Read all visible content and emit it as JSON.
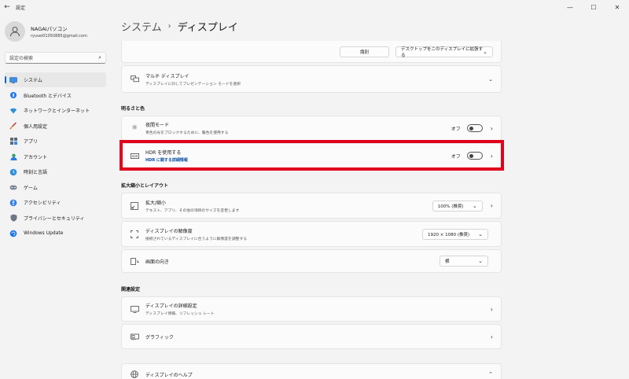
{
  "window": {
    "title": "設定",
    "back": "←",
    "min": "—",
    "max": "☐",
    "close": "✕"
  },
  "profile": {
    "name": "NAGAIパソコン",
    "email": "ryusei01050885@gmail.com"
  },
  "search": {
    "placeholder": "設定の検索"
  },
  "sidebar": {
    "items": [
      {
        "label": "システム",
        "icon": "monitor-icon",
        "active": true
      },
      {
        "label": "Bluetooth とデバイス",
        "icon": "bluetooth-icon"
      },
      {
        "label": "ネットワークとインターネット",
        "icon": "wifi-icon"
      },
      {
        "label": "個人用設定",
        "icon": "brush-icon"
      },
      {
        "label": "アプリ",
        "icon": "apps-icon"
      },
      {
        "label": "アカウント",
        "icon": "person-icon"
      },
      {
        "label": "時刻と言語",
        "icon": "globe-clock-icon"
      },
      {
        "label": "ゲーム",
        "icon": "gamepad-icon"
      },
      {
        "label": "アクセシビリティ",
        "icon": "accessibility-icon"
      },
      {
        "label": "プライバシーとセキュリティ",
        "icon": "shield-icon"
      },
      {
        "label": "Windows Update",
        "icon": "update-icon"
      }
    ]
  },
  "breadcrumb": {
    "parent": "システム",
    "separator": "›",
    "current": "ディスプレイ"
  },
  "top_card": {
    "identify": "識別",
    "extend": "デスクトップをこのディスプレイに拡張する"
  },
  "multi_display": {
    "title": "マルチ ディスプレイ",
    "subtitle": "ディスプレイに対してプレゼンテーション モードを選択"
  },
  "sections": {
    "brightness": "明るさと色",
    "scale_layout": "拡大縮小とレイアウト",
    "related": "関連設定"
  },
  "night_light": {
    "title": "夜間モード",
    "subtitle": "青色の光をブロックするために、暖色を使用する",
    "state": "オフ"
  },
  "hdr": {
    "title": "HDR を使用する",
    "link": "HDR に関する詳細情報",
    "state": "オフ"
  },
  "scale": {
    "title": "拡大/縮小",
    "subtitle": "テキスト、アプリ、その他の項目のサイズを変更します",
    "value": "100% (推奨)"
  },
  "resolution": {
    "title": "ディスプレイの解像度",
    "subtitle": "接続されているディスプレイに合うように解像度を調整する",
    "value": "1920 × 1080 (推奨)"
  },
  "orientation": {
    "title": "画面の向き",
    "value": "横"
  },
  "advanced": {
    "title": "ディスプレイの詳細設定",
    "subtitle": "ディスプレイ情報、リフレッシュ レート"
  },
  "graphics": {
    "title": "グラフィック"
  },
  "help": {
    "title": "ディスプレイのヘルプ"
  },
  "colors": {
    "accent": "#0067c0",
    "highlight": "#e0001b",
    "link": "#0b4fa3"
  }
}
